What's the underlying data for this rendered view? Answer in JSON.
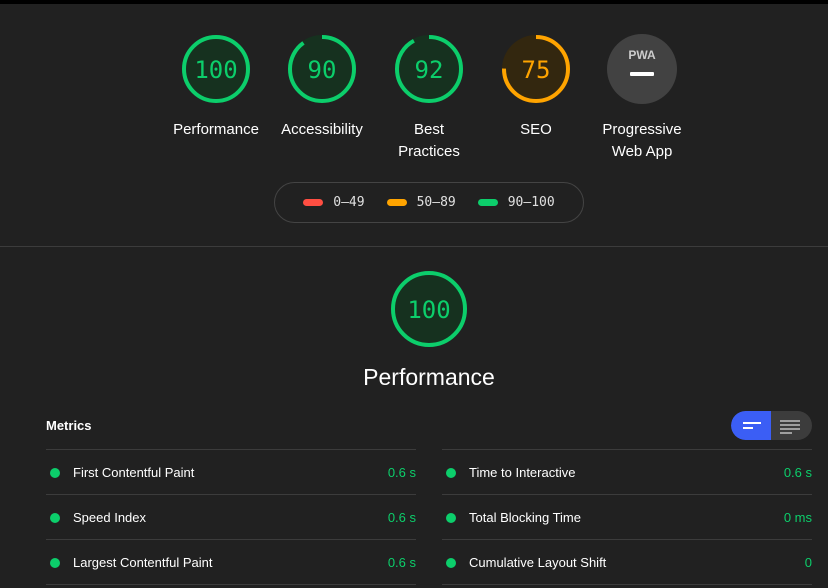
{
  "colors": {
    "pass": "#0cce6b",
    "average": "#ffa400",
    "fail": "#ff4e42",
    "background": "#212121",
    "toggle_active": "#3b5ef5"
  },
  "categories": [
    {
      "label": "Performance",
      "score": "100",
      "status": "pass"
    },
    {
      "label": "Accessibility",
      "score": "90",
      "status": "pass"
    },
    {
      "label": "Best Practices",
      "score": "92",
      "status": "pass"
    },
    {
      "label": "SEO",
      "score": "75",
      "status": "average"
    },
    {
      "label": "Progressive Web App",
      "badge": "PWA",
      "icon": "pwa-icon"
    }
  ],
  "legend": [
    {
      "range": "0–49",
      "status": "fail"
    },
    {
      "range": "50–89",
      "status": "average"
    },
    {
      "range": "90–100",
      "status": "pass"
    }
  ],
  "performance": {
    "score": "100",
    "title": "Performance"
  },
  "metrics": {
    "header": "Metrics",
    "view_toggle": {
      "active": "compact-view-icon",
      "inactive": "detailed-view-icon"
    },
    "left": [
      {
        "name": "First Contentful Paint",
        "value": "0.6 s"
      },
      {
        "name": "Speed Index",
        "value": "0.6 s"
      },
      {
        "name": "Largest Contentful Paint",
        "value": "0.6 s"
      }
    ],
    "right": [
      {
        "name": "Time to Interactive",
        "value": "0.6 s"
      },
      {
        "name": "Total Blocking Time",
        "value": "0 ms"
      },
      {
        "name": "Cumulative Layout Shift",
        "value": "0"
      }
    ]
  }
}
